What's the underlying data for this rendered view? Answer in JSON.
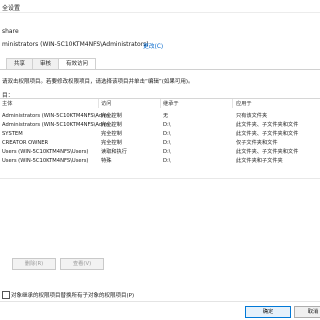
{
  "window": {
    "title": "全设置"
  },
  "name": {
    "value": "share"
  },
  "owner": {
    "value": "ministrators (WIN-5C10KTM4NFS\\Administrators)",
    "change_link": "更改(C)"
  },
  "tabs": [
    {
      "label": "共享",
      "active": false
    },
    {
      "label": "审核",
      "active": false
    },
    {
      "label": "有效访问",
      "active": true
    }
  ],
  "info_text": "请双击权限项目。若要修改权限项目，请选择该项目并单击“编辑”(如果可用)。",
  "perm_heading": "目：",
  "columns": {
    "principal": "主体",
    "access": "访问",
    "inherited_from": "继承于",
    "applies_to": "应用于"
  },
  "rows": [
    {
      "principal": "Administrators (WIN-5C10KTM4NFS\\Admi...",
      "access": "完全控制",
      "inherited_from": "无",
      "applies_to": "只有该文件夹"
    },
    {
      "principal": "Administrators (WIN-5C10KTM4NFS\\Admi...",
      "access": "完全控制",
      "inherited_from": "D:\\",
      "applies_to": "此文件夹、子文件夹和文件"
    },
    {
      "principal": "SYSTEM",
      "access": "完全控制",
      "inherited_from": "D:\\",
      "applies_to": "此文件夹、子文件夹和文件"
    },
    {
      "principal": "CREATOR OWNER",
      "access": "完全控制",
      "inherited_from": "D:\\",
      "applies_to": "仅子文件夹和文件"
    },
    {
      "principal": "Users (WIN-5C10KTM4NFS\\Users)",
      "access": "读取和执行",
      "inherited_from": "D:\\",
      "applies_to": "此文件夹、子文件夹和文件"
    },
    {
      "principal": "Users (WIN-5C10KTM4NFS\\Users)",
      "access": "特殊",
      "inherited_from": "D:\\",
      "applies_to": "此文件夹和子文件夹"
    }
  ],
  "buttons": {
    "remove": "删除(R)",
    "view": "查看(V)",
    "ok": "确定",
    "cancel": "取消"
  },
  "replace_checkbox": {
    "label": "对象继承的权限项目替换所有子对象的权限项目(P)",
    "checked": false
  }
}
